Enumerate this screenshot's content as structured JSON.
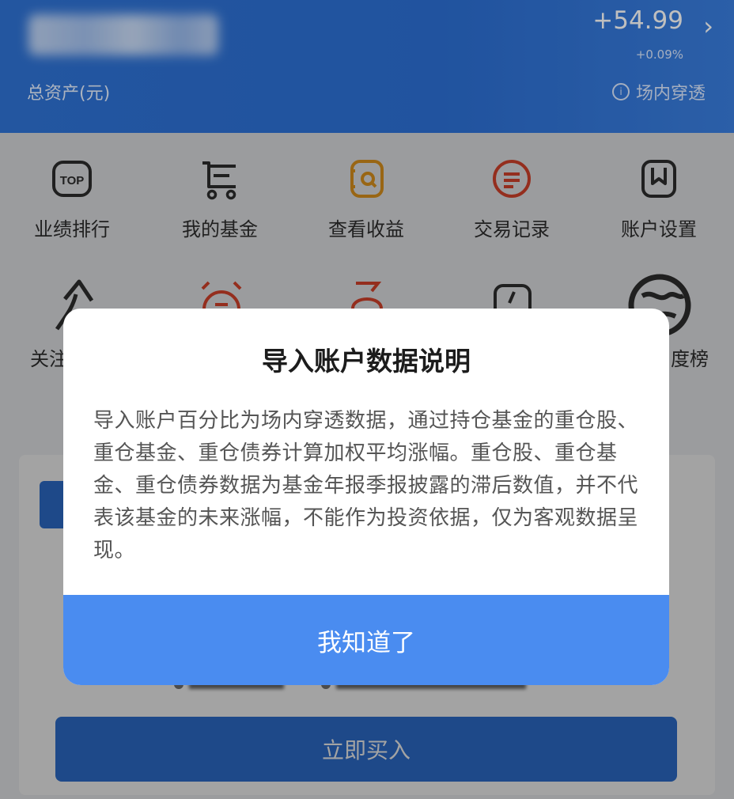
{
  "header": {
    "total_assets_label": "总资产(元)",
    "day_change": "+54.99",
    "day_change_pct": "+0.09%",
    "penetrate_label": "场内穿透"
  },
  "grid": {
    "row1": [
      {
        "label": "业绩排行",
        "icon": "top-icon"
      },
      {
        "label": "我的基金",
        "icon": "cart-icon"
      },
      {
        "label": "查看收益",
        "icon": "wallet-icon"
      },
      {
        "label": "交易记录",
        "icon": "record-icon"
      },
      {
        "label": "账户设置",
        "icon": "bookmark-icon"
      }
    ],
    "row2_left_partial": "关注",
    "row2_right_partial": "度榜"
  },
  "modal": {
    "title": "导入账户数据说明",
    "body": "导入账户百分比为场内穿透数据，通过持仓基金的重仓股、重仓基金、重仓债券计算加权平均涨幅。重仓股、重仓基金、重仓债券数据为基金年报季报披露的滞后数值，并不代表该基金的未来涨幅，不能作为投资依据，仅为客观数据呈现。",
    "confirm_label": "我知道了"
  },
  "bottom": {
    "buy_label": "立即买入"
  },
  "colors": {
    "brand_blue": "#2f73d6",
    "modal_button": "#4a8cf0",
    "accent_orange": "#f0a020",
    "accent_red": "#e8492f"
  }
}
